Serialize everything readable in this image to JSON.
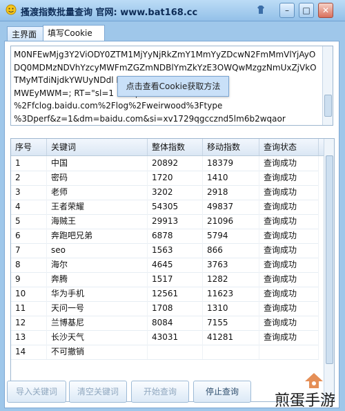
{
  "window": {
    "title": "搔渡指数批量查询   官网: www.bat168.cc"
  },
  "tabs": [
    {
      "label": "主界面"
    },
    {
      "label": "填写Cookie"
    }
  ],
  "cookie": {
    "text": "M0NFEwMjg3Y2ViODY0ZTM1MjYyNjRkZmY1MmYyZDcwN2FmMmVlYjAyO\nDQ0MDMzNDVhYzcyMWFmZGZmNDBlYmZkYzE3OWQwMzgzNmUxZjVkO\nTMyMTdiNjdkYWUyNDdl                         MzFiY2I2XzdfMmMz\nMWEyMWM=; RT=\"sl=1                           =https%3A%2F\n%2Ffclog.baidu.com%2Flog%2Fweirwood%3Ftype\n%3Dperf&z=1&dm=baidu.com&si=xv1729qgccznd5lm6b2wqaor"
  },
  "tooltip": "点击查看Cookie获取方法",
  "grid": {
    "columns": [
      "序号",
      "关键词",
      "整体指数",
      "移动指数",
      "查询状态"
    ],
    "rows": [
      [
        "1",
        "中国",
        "20892",
        "18379",
        "查询成功"
      ],
      [
        "2",
        "密码",
        "1720",
        "1410",
        "查询成功"
      ],
      [
        "3",
        "老师",
        "3202",
        "2918",
        "查询成功"
      ],
      [
        "4",
        "王者荣耀",
        "54305",
        "49837",
        "查询成功"
      ],
      [
        "5",
        "海贼王",
        "29913",
        "21096",
        "查询成功"
      ],
      [
        "6",
        "奔跑吧兄弟",
        "6878",
        "5794",
        "查询成功"
      ],
      [
        "7",
        "seo",
        "1563",
        "866",
        "查询成功"
      ],
      [
        "8",
        "海尔",
        "4645",
        "3763",
        "查询成功"
      ],
      [
        "9",
        "奔腾",
        "1517",
        "1282",
        "查询成功"
      ],
      [
        "10",
        "华为手机",
        "12561",
        "11623",
        "查询成功"
      ],
      [
        "11",
        "天问一号",
        "1708",
        "1310",
        "查询成功"
      ],
      [
        "12",
        "兰博基尼",
        "8084",
        "7155",
        "查询成功"
      ],
      [
        "13",
        "长沙天气",
        "43031",
        "41281",
        "查询成功"
      ],
      [
        "14",
        "不可撤销",
        "",
        "",
        ""
      ]
    ]
  },
  "buttons": {
    "import": "导入关键词",
    "clear": "清空关键词",
    "start": "开始查询",
    "stop": "停止查询"
  },
  "watermark": "煎蛋手游"
}
